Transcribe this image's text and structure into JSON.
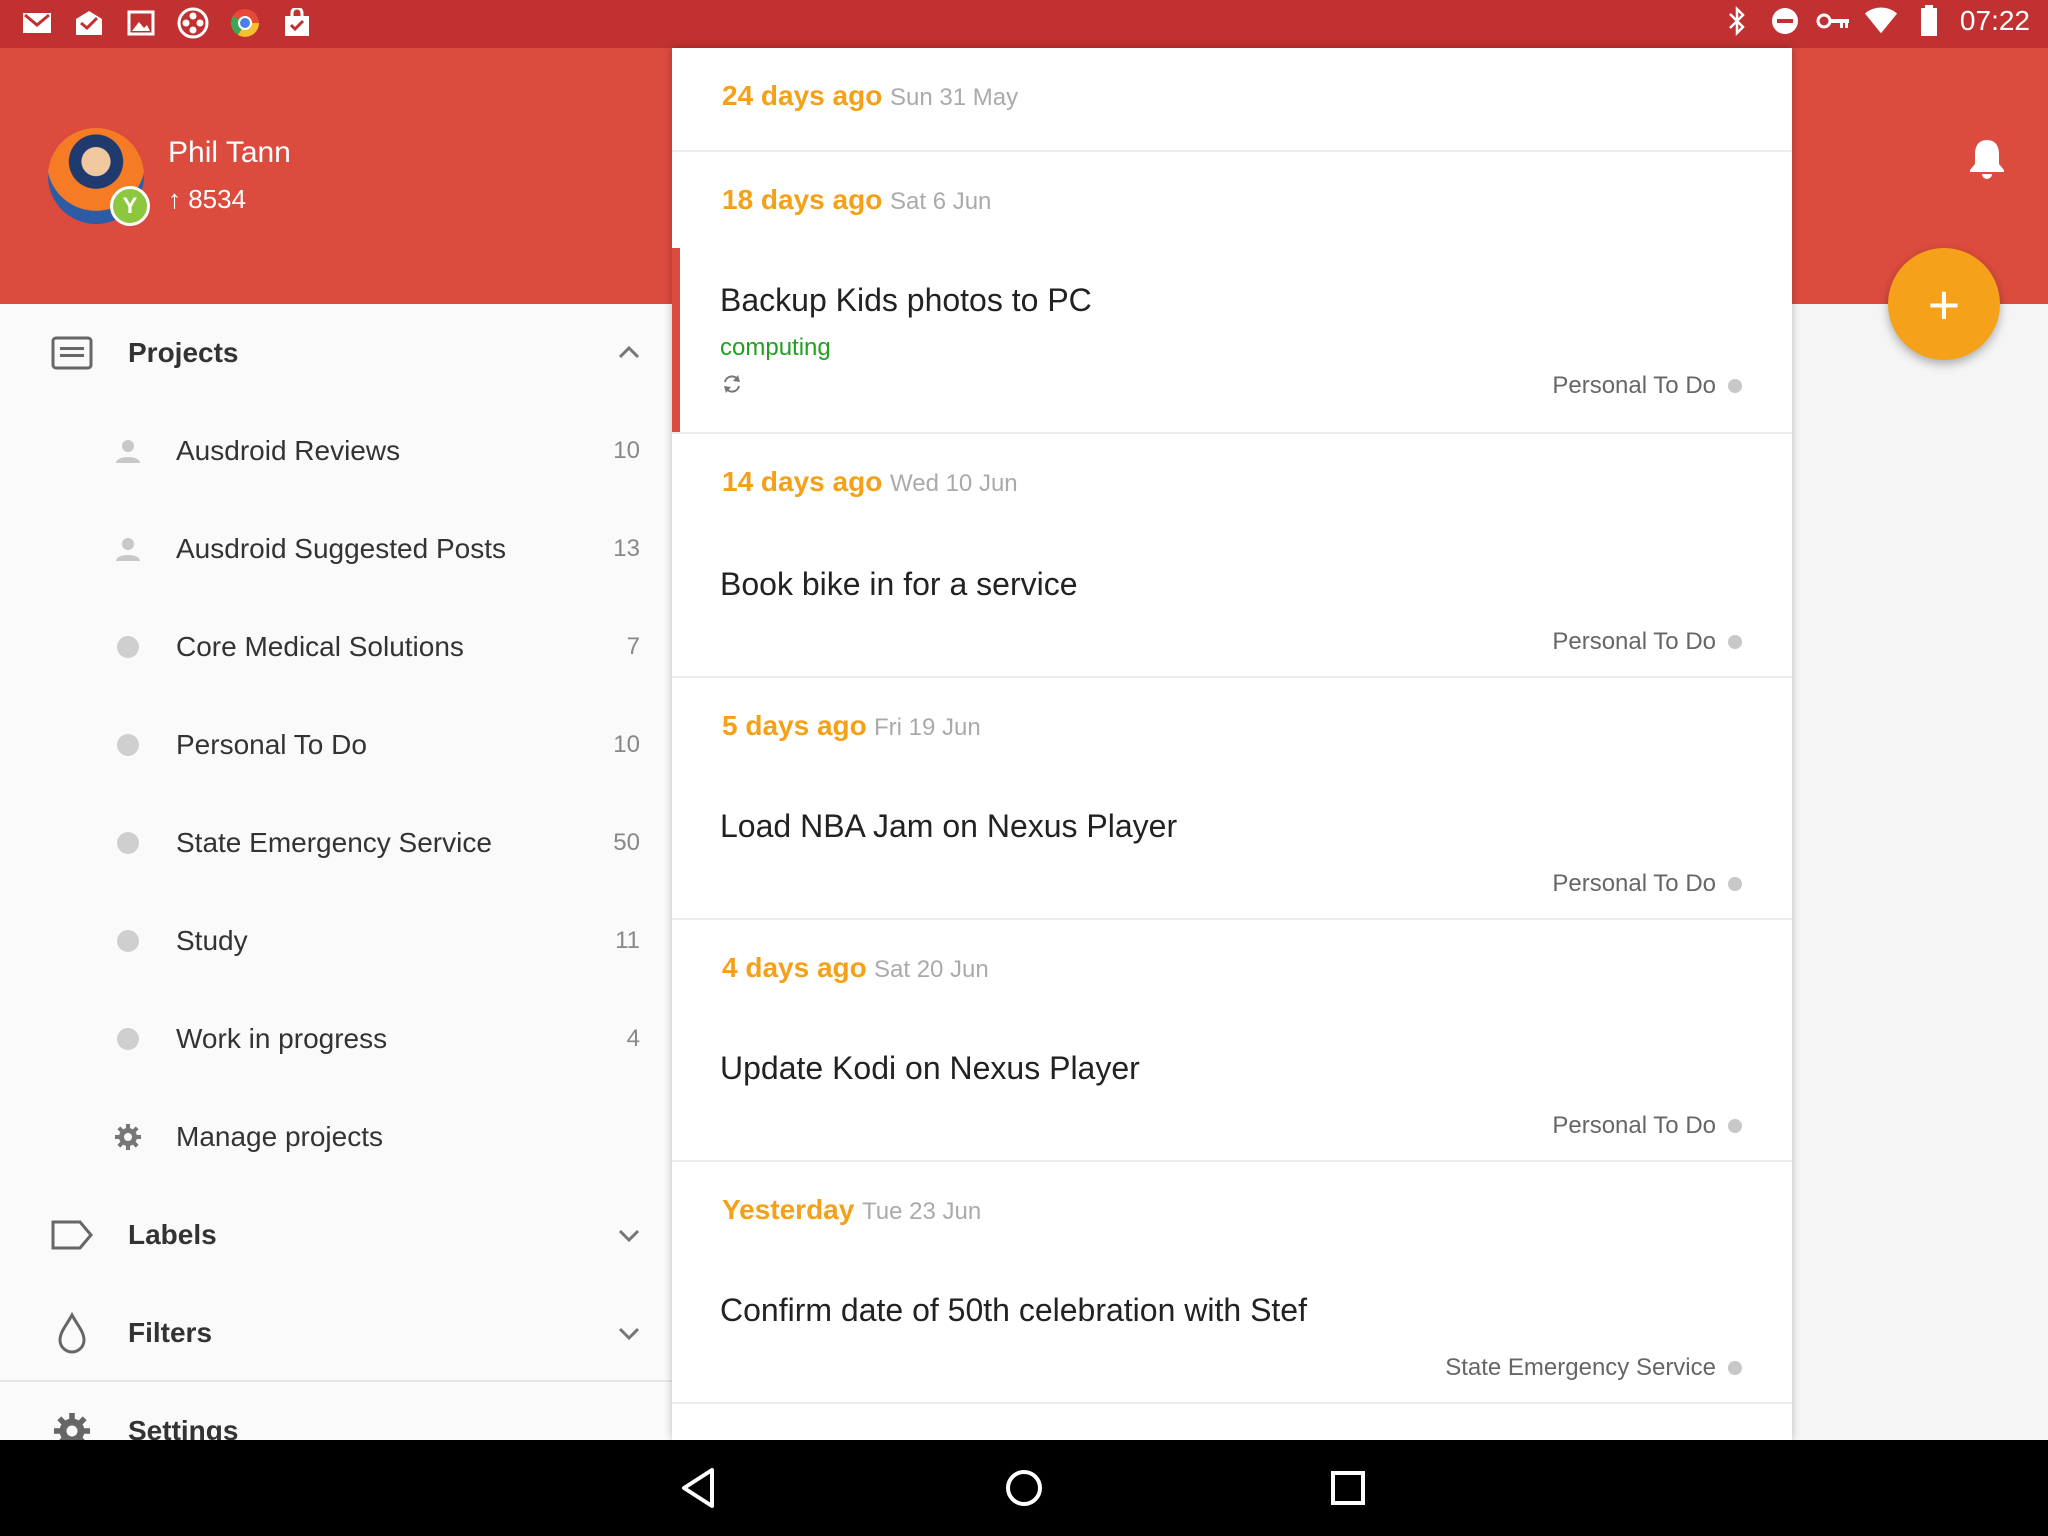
{
  "status_bar": {
    "time": "07:22",
    "icons_left": [
      "gmail-icon",
      "inbox-icon",
      "gallery-icon",
      "film-reel-icon",
      "chrome-icon",
      "shopping-bag-icon"
    ],
    "icons_right": [
      "bluetooth-icon",
      "do-not-disturb-icon",
      "vpn-key-icon",
      "wifi-icon",
      "battery-icon"
    ]
  },
  "header": {
    "user_name": "Phil Tann",
    "karma": "↑ 8534",
    "badge": "Y"
  },
  "sidebar": {
    "projects_label": "Projects",
    "projects": [
      {
        "name": "Ausdroid Reviews",
        "count": "10",
        "icon": "person-icon"
      },
      {
        "name": "Ausdroid Suggested Posts",
        "count": "13",
        "icon": "person-icon"
      },
      {
        "name": "Core Medical Solutions",
        "count": "7",
        "icon": "dot"
      },
      {
        "name": "Personal To Do",
        "count": "10",
        "icon": "dot"
      },
      {
        "name": "State Emergency Service",
        "count": "50",
        "icon": "dot"
      },
      {
        "name": "Study",
        "count": "11",
        "icon": "dot"
      },
      {
        "name": "Work in progress",
        "count": "4",
        "icon": "dot"
      }
    ],
    "manage_label": "Manage projects",
    "labels_label": "Labels",
    "filters_label": "Filters",
    "settings_label": "Settings"
  },
  "tasks": {
    "groups": [
      {
        "relative": "24 days ago",
        "date": "Sun 31 May",
        "tasks": []
      },
      {
        "relative": "18 days ago",
        "date": "Sat 6 Jun",
        "tasks": [
          {
            "title": "Backup Kids photos to PC",
            "label": "computing",
            "project": "Personal To Do",
            "recurring": true
          }
        ]
      },
      {
        "relative": "14 days ago",
        "date": "Wed 10 Jun",
        "tasks": [
          {
            "title": "Book bike in for a service",
            "project": "Personal To Do"
          }
        ]
      },
      {
        "relative": "5 days ago",
        "date": "Fri 19 Jun",
        "tasks": [
          {
            "title": "Load NBA Jam on Nexus Player",
            "project": "Personal To Do"
          }
        ]
      },
      {
        "relative": "4 days ago",
        "date": "Sat 20 Jun",
        "tasks": [
          {
            "title": "Update Kodi on Nexus Player",
            "project": "Personal To Do"
          }
        ]
      },
      {
        "relative": "Yesterday",
        "date": "Tue 23 Jun",
        "tasks": [
          {
            "title": "Confirm date of 50th celebration with Stef",
            "project": "State Emergency Service"
          }
        ]
      }
    ]
  },
  "fab": {
    "symbol": "+"
  },
  "colors": {
    "status_bar": "#c13131",
    "header": "#db4c3f",
    "accent": "#f6a11a",
    "date_text": "#f4a019",
    "label_green": "#20a020"
  }
}
